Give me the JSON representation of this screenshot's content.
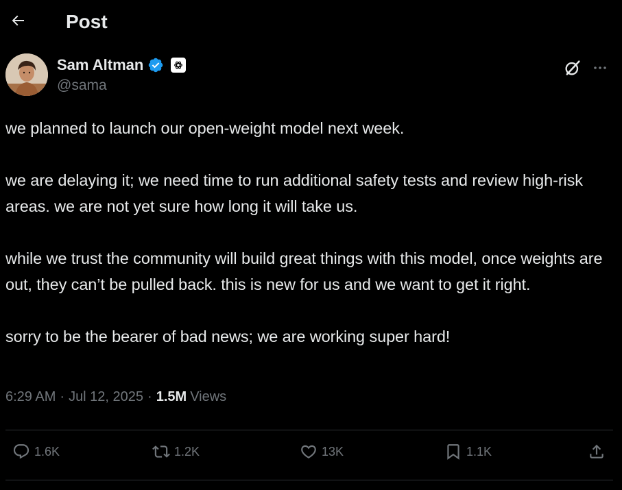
{
  "header": {
    "back_icon": "arrow-left-icon",
    "title": "Post"
  },
  "author": {
    "display_name": "Sam Altman",
    "handle": "@sama",
    "verified_icon": "verified-badge-icon",
    "org_badge_icon": "openai-logo-icon",
    "verified_color": "#1d9bf0"
  },
  "tweet": {
    "paragraphs": [
      "we planned to launch our open-weight model next week.",
      "we are delaying it; we need time to run additional safety tests and review high-risk areas. we are not yet sure how long it will take us.",
      "while we trust the community will build great things with this model, once weights are out, they can’t be pulled back. this is new for us and we want to get it right.",
      "sorry to be the bearer of bad news; we are working super hard!"
    ]
  },
  "meta": {
    "time": "6:29 AM",
    "separator": "·",
    "date": "Jul 12, 2025",
    "views_count": "1.5M",
    "views_label": "Views"
  },
  "actions": {
    "reply_count": "1.6K",
    "repost_count": "1.2K",
    "like_count": "13K",
    "bookmark_count": "1.1K"
  },
  "colors": {
    "background": "#000000",
    "text_primary": "#e7e9ea",
    "text_secondary": "#71767b",
    "divider": "#2f3336"
  }
}
